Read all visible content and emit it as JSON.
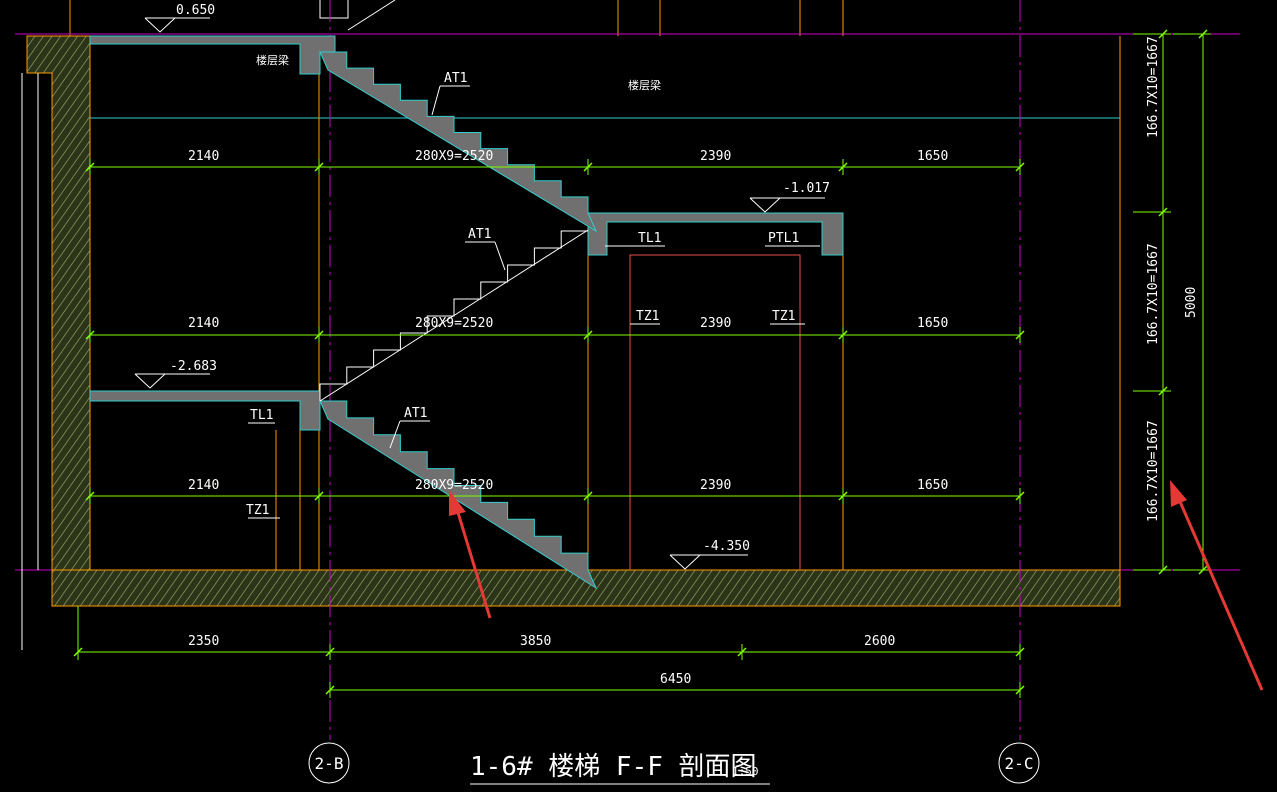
{
  "drawing": {
    "title": "1-6#  楼梯 F-F 剖面图",
    "scale": "1:50",
    "colors": {
      "background": "#000000",
      "dimension": "#7fff00",
      "outline": "#ff3399",
      "stair_edge": "#33cccc",
      "stair_fill": "#707070",
      "hatch": "#9aaa66",
      "axis": "#cc00cc",
      "text": "#ffffff",
      "orange": "#ff9900",
      "red_line": "#e6504a",
      "arrow": "#e53935"
    }
  },
  "axes": {
    "left": "2-B",
    "right": "2-C"
  },
  "levels": {
    "top": "0.650",
    "mid": "-1.017",
    "lower": "-2.683",
    "bottom": "-4.350"
  },
  "labels": {
    "floor_beam_1": "楼层梁",
    "floor_beam_2": "楼层梁",
    "at1_a": "AT1",
    "at1_b": "AT1",
    "at1_c": "AT1",
    "tl1_a": "TL1",
    "tl1_b": "TL1",
    "ptl1": "PTL1",
    "tz1_a": "TZ1",
    "tz1_b": "TZ1",
    "tz1_c": "TZ1"
  },
  "row1": {
    "d1": "2140",
    "d2": "280X9=2520",
    "d3": "2390",
    "d4": "1650"
  },
  "row2": {
    "d1": "2140",
    "d2": "280X9=2520",
    "d3": "2390",
    "d4": "1650"
  },
  "row3": {
    "d1": "2140",
    "d2": "280X9=2520",
    "d3": "2390",
    "d4": "1650"
  },
  "bottom_dims": {
    "d1": "2350",
    "d2": "3850",
    "d3": "2600",
    "total": "6450"
  },
  "vertical_dims": {
    "seg1": "166.7X10=1667",
    "seg2": "166.7X10=1667",
    "seg3": "166.7X10=1667",
    "total": "5000"
  }
}
